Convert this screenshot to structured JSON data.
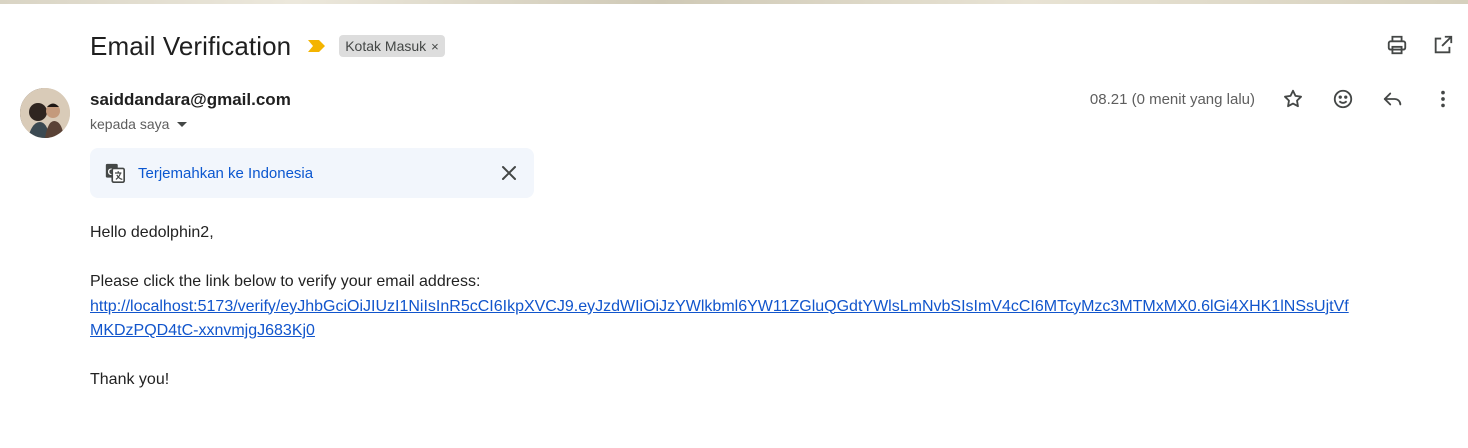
{
  "email": {
    "subject": "Email Verification",
    "label_chip": {
      "text": "Kotak Masuk",
      "remove_glyph": "×"
    },
    "sender": "saiddandara@gmail.com",
    "recipient_label": "kepada saya",
    "timestamp": "08.21 (0 menit yang lalu)",
    "translate_bar": {
      "link_text": "Terjemahkan ke Indonesia"
    },
    "body": {
      "greeting": "Hello dedolphin2,",
      "instruction": "Please click the link below to verify your email address:",
      "link": "http://localhost:5173/verify/eyJhbGciOiJIUzI1NiIsInR5cCI6IkpXVCJ9.eyJzdWIiOiJzYWlkbml6YW11ZGluQGdtYWlsLmNvbSIsImV4cCI6MTcyMzc3MTMxMX0.6lGi4XHK1lNSsUjtVfMKDzPQD4tC-xxnvmjgJ683Kj0",
      "closing": "Thank you!"
    }
  },
  "icons": {
    "importance": "importance-marker-icon",
    "print": "print-icon",
    "open_new_window": "open-in-new-window-icon",
    "star": "star-icon",
    "emoji": "emoji-reaction-icon",
    "reply": "reply-icon",
    "more": "more-vertical-icon",
    "translate": "translate-icon",
    "close": "close-icon"
  },
  "colors": {
    "importance": "#f4b400",
    "link": "#1155cc",
    "translate_link": "#0b57d0",
    "translate_bar_bg": "#f2f6fc",
    "chip_bg": "#dddddd"
  }
}
